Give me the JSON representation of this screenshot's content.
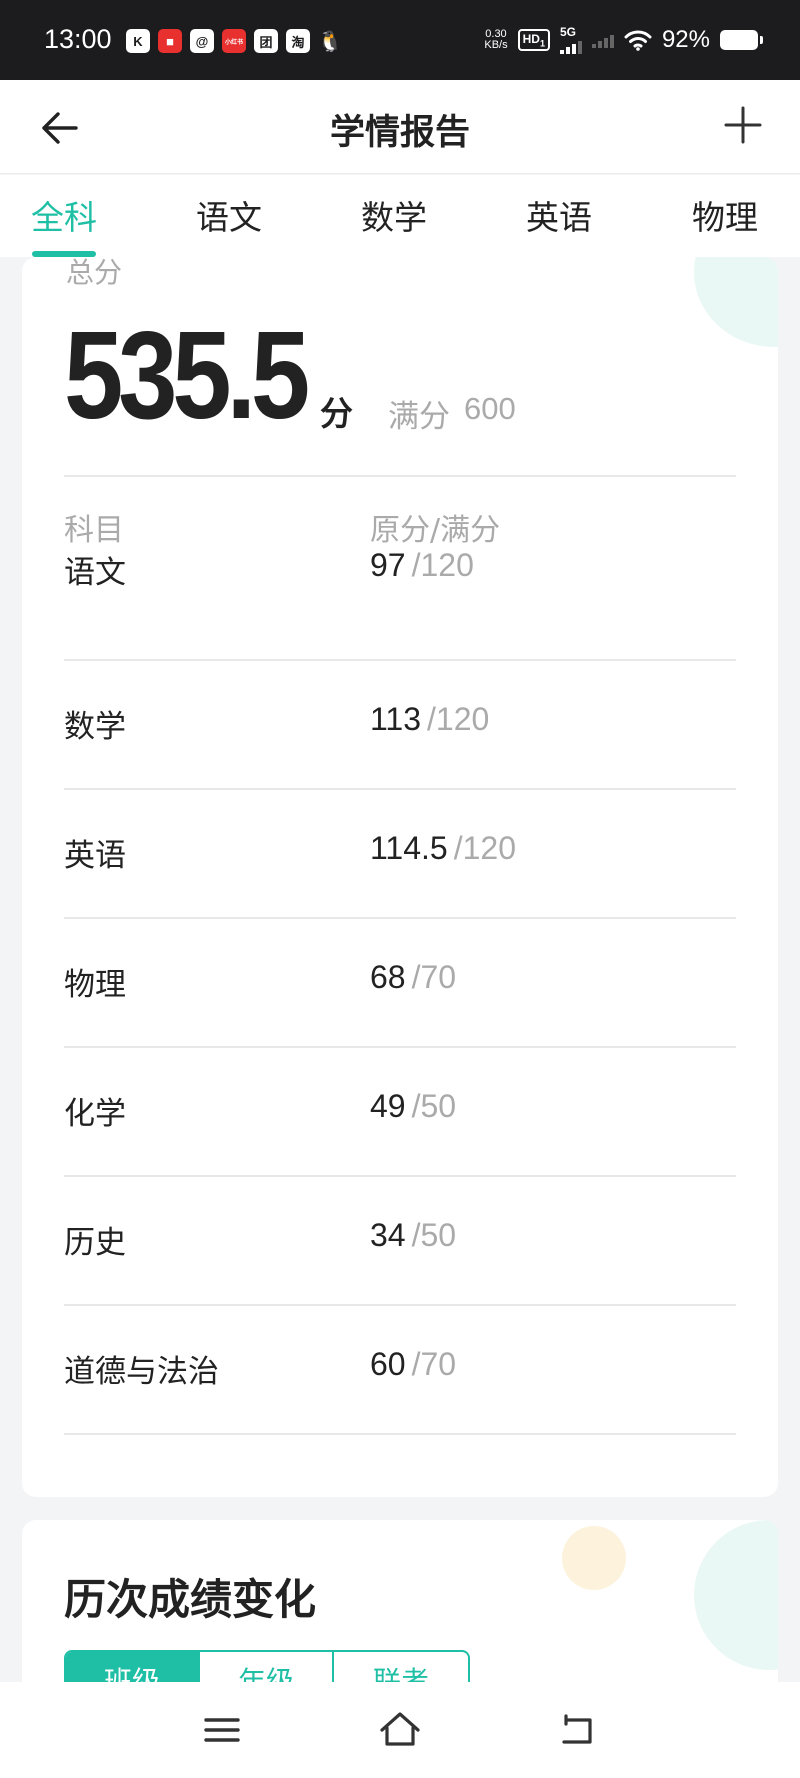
{
  "status_bar": {
    "time": "13:00",
    "app_icons": [
      {
        "name": "kuaishou-icon",
        "glyph": "K"
      },
      {
        "name": "app-red-icon",
        "glyph": "■"
      },
      {
        "name": "at-app-icon",
        "glyph": "@"
      },
      {
        "name": "xiaohongshu-icon",
        "glyph": "小红书"
      },
      {
        "name": "meituan-icon",
        "glyph": "团"
      },
      {
        "name": "taobao-icon",
        "glyph": "淘"
      },
      {
        "name": "qq-icon",
        "glyph": "🐧"
      }
    ],
    "net_speed_value": "0.30",
    "net_speed_unit": "KB/s",
    "hd_label": "HD",
    "hd_sub": "1",
    "signal_label": "5G",
    "battery_percent": "92%"
  },
  "header": {
    "title": "学情报告"
  },
  "tabs": [
    {
      "label": "全科",
      "active": true
    },
    {
      "label": "语文",
      "active": false
    },
    {
      "label": "数学",
      "active": false
    },
    {
      "label": "英语",
      "active": false
    },
    {
      "label": "物理",
      "active": false
    }
  ],
  "score_card": {
    "total_label": "总分",
    "total_value": "535.5",
    "total_unit": "分",
    "full_label": "满分",
    "full_value": "600",
    "col_subject": "科目",
    "col_score": "原分/满分",
    "rows": [
      {
        "subject": "语文",
        "raw": "97",
        "full": "/120"
      },
      {
        "subject": "数学",
        "raw": "113",
        "full": "/120"
      },
      {
        "subject": "英语",
        "raw": "114.5",
        "full": "/120"
      },
      {
        "subject": "物理",
        "raw": "68",
        "full": "/70"
      },
      {
        "subject": "化学",
        "raw": "49",
        "full": "/50"
      },
      {
        "subject": "历史",
        "raw": "34",
        "full": "/50"
      },
      {
        "subject": "道德与法治",
        "raw": "60",
        "full": "/70"
      }
    ]
  },
  "history": {
    "title": "历次成绩变化",
    "segments": [
      {
        "label": "班级",
        "active": true
      },
      {
        "label": "年级",
        "active": false
      },
      {
        "label": "联考",
        "active": false
      }
    ]
  },
  "colors": {
    "accent": "#1fbfa6",
    "muted_text": "#aaaaaa",
    "primary_text": "#222222"
  },
  "icons": {
    "back": "back-arrow-icon",
    "add": "plus-icon",
    "menu": "menu-icon",
    "home": "home-icon",
    "return": "return-icon"
  }
}
